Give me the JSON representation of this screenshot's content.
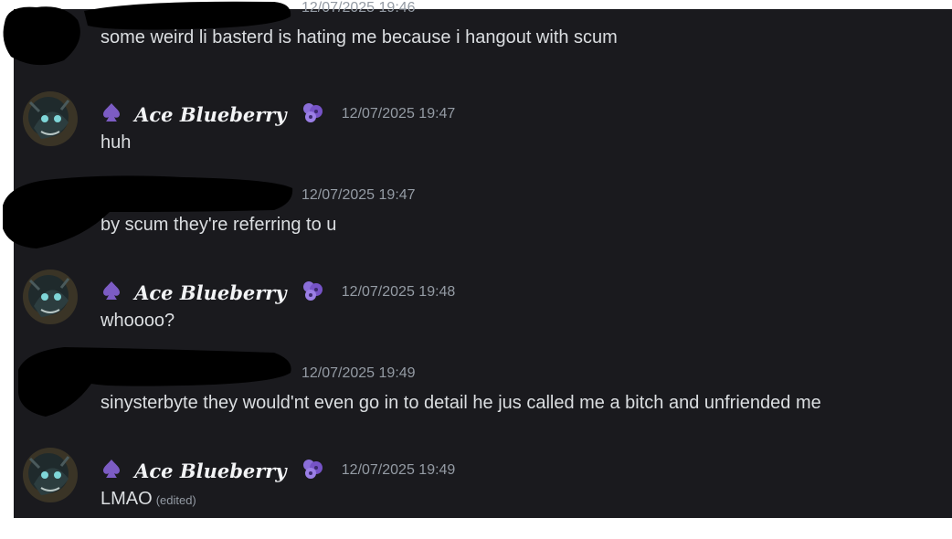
{
  "colors": {
    "background": "#1a1a1e",
    "message_text": "#dbdee1",
    "username": "#f2f3f5",
    "timestamp": "#949ba4",
    "role_icon": "#7c5cc4",
    "redaction": "#000000"
  },
  "icons": {
    "role": "spade-icon",
    "tag": "blueberry-icon"
  },
  "messages": [
    {
      "author": "",
      "redacted": true,
      "timestamp": "12/07/2025 19:46",
      "text": "some weird li basterd is hating me because i hangout with scum"
    },
    {
      "author": "Ace Blueberry",
      "redacted": false,
      "timestamp": "12/07/2025 19:47",
      "text": "huh"
    },
    {
      "author": "",
      "redacted": true,
      "timestamp": "12/07/2025 19:47",
      "text": "by scum they're referring to u"
    },
    {
      "author": "Ace Blueberry",
      "redacted": false,
      "timestamp": "12/07/2025 19:48",
      "text": "whoooo?"
    },
    {
      "author": "",
      "redacted": true,
      "timestamp": "12/07/2025 19:49",
      "text": "sinysterbyte they would'nt even go in to detail he jus called me a bitch and unfriended me"
    },
    {
      "author": "Ace Blueberry",
      "redacted": false,
      "timestamp": "12/07/2025 19:49",
      "text": "LMAO",
      "edited_label": "(edited)"
    }
  ]
}
